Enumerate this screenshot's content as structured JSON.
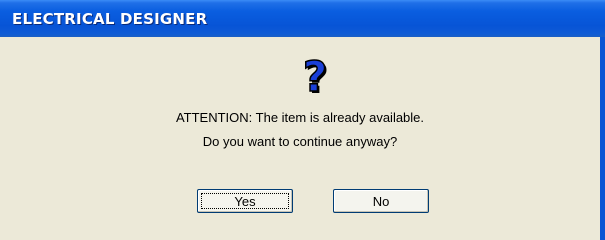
{
  "window": {
    "title": "ELECTRICAL DESIGNER"
  },
  "dialog": {
    "icon": "question-mark-icon",
    "message_line1": "ATTENTION: The item is already available.",
    "message_line2": "Do you want to continue anyway?",
    "buttons": {
      "yes_label": "Yes",
      "no_label": "No"
    }
  },
  "colors": {
    "titlebar": "#0a5ee0",
    "client": "#ece9d8",
    "icon_blue": "#1a3fd8"
  }
}
